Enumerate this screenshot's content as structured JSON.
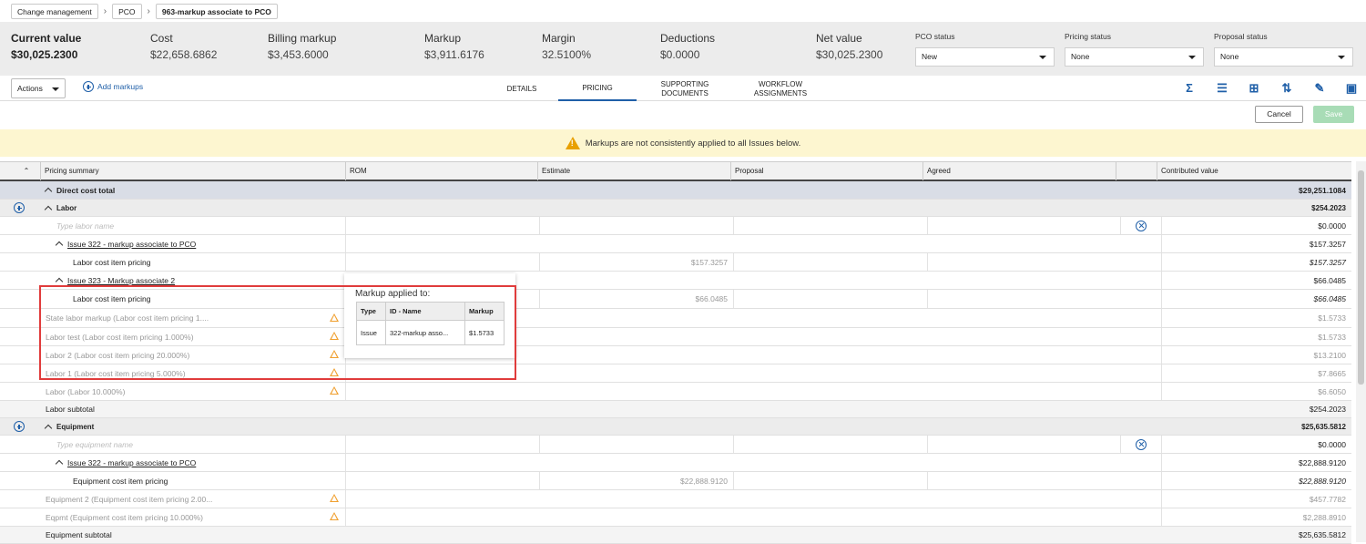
{
  "breadcrumb": [
    "Change management",
    "PCO",
    "963-markup associate to PCO"
  ],
  "summary": [
    {
      "label": "Current value",
      "value": "$30,025.2300"
    },
    {
      "label": "Cost",
      "value": "$22,658.6862"
    },
    {
      "label": "Billing markup",
      "value": "$3,453.6000"
    },
    {
      "label": "Markup",
      "value": "$3,911.6176"
    },
    {
      "label": "Margin",
      "value": "32.5100%"
    },
    {
      "label": "Deductions",
      "value": "$0.0000"
    },
    {
      "label": "Net value",
      "value": "$30,025.2300"
    }
  ],
  "statuses": [
    {
      "label": "PCO status",
      "value": "New"
    },
    {
      "label": "Pricing status",
      "value": "None"
    },
    {
      "label": "Proposal status",
      "value": "None"
    }
  ],
  "toolbar": {
    "actions": "Actions",
    "add_markups": "Add markups",
    "tabs": [
      {
        "l1": "DETAILS",
        "l2": ""
      },
      {
        "l1": "PRICING",
        "l2": ""
      },
      {
        "l1": "SUPPORTING",
        "l2": "DOCUMENTS"
      },
      {
        "l1": "WORKFLOW",
        "l2": "ASSIGNMENTS"
      }
    ],
    "icons": [
      "sigma-icon",
      "list-icon",
      "add-page-icon",
      "sort-icon",
      "edit-document-icon",
      "comment-icon"
    ],
    "cancel": "Cancel",
    "save": "Save"
  },
  "warning": "Markups are not consistently applied to all Issues below.",
  "columns": [
    "Pricing summary",
    "ROM",
    "Estimate",
    "Proposal",
    "Agreed",
    "",
    "Contributed value"
  ],
  "rows": [
    {
      "label": "Direct cost total",
      "value": "$29,251.1084",
      "estimate": ""
    },
    {
      "label": "Labor",
      "value": "$254.2023",
      "estimate": ""
    },
    {
      "label": "Type labor name",
      "value": "$0.0000",
      "estimate": ""
    },
    {
      "label": "Issue 322 - markup associate to PCO",
      "value": "$157.3257",
      "estimate": ""
    },
    {
      "label": "Labor cost item pricing",
      "value": "$157.3257",
      "estimate": "$157.3257"
    },
    {
      "label": "Issue 323 - Markup associate 2",
      "value": "$66.0485",
      "estimate": ""
    },
    {
      "label": "Labor cost item pricing",
      "value": "$66.0485",
      "estimate": "$66.0485"
    },
    {
      "label": "State labor markup (Labor cost item pricing 1....",
      "value": "$1.5733",
      "estimate": ""
    },
    {
      "label": "Labor test (Labor cost item pricing 1.000%)",
      "value": "$1.5733",
      "estimate": ""
    },
    {
      "label": "Labor 2 (Labor cost item pricing 20.000%)",
      "value": "$13.2100",
      "estimate": ""
    },
    {
      "label": "Labor 1 (Labor cost item pricing 5.000%)",
      "value": "$7.8665",
      "estimate": ""
    },
    {
      "label": "Labor (Labor 10.000%)",
      "value": "$6.6050",
      "estimate": ""
    },
    {
      "label": "Labor subtotal",
      "value": "$254.2023",
      "estimate": ""
    },
    {
      "label": "Equipment",
      "value": "$25,635.5812",
      "estimate": ""
    },
    {
      "label": "Type equipment name",
      "value": "$0.0000",
      "estimate": ""
    },
    {
      "label": "Issue 322 - markup associate to PCO",
      "value": "$22,888.9120",
      "estimate": ""
    },
    {
      "label": "Equipment cost item pricing",
      "value": "$22,888.9120",
      "estimate": "$22,888.9120"
    },
    {
      "label": "Equipment 2 (Equipment cost item pricing 2.00...",
      "value": "$457.7782",
      "estimate": ""
    },
    {
      "label": "Eqpmt (Equipment cost item pricing 10.000%)",
      "value": "$2,288.8910",
      "estimate": ""
    },
    {
      "label": "Equipment subtotal",
      "value": "$25,635.5812",
      "estimate": ""
    }
  ],
  "popup": {
    "title": "Markup applied to:",
    "headers": [
      "Type",
      "ID - Name",
      "Markup"
    ],
    "row": [
      "Issue",
      "322-markup asso...",
      "$1.5733"
    ]
  },
  "colors": {
    "accent": "#1f5fa8",
    "warning": "#e8a000",
    "highlight": "#e03c3c",
    "save": "#a8dcb6"
  }
}
